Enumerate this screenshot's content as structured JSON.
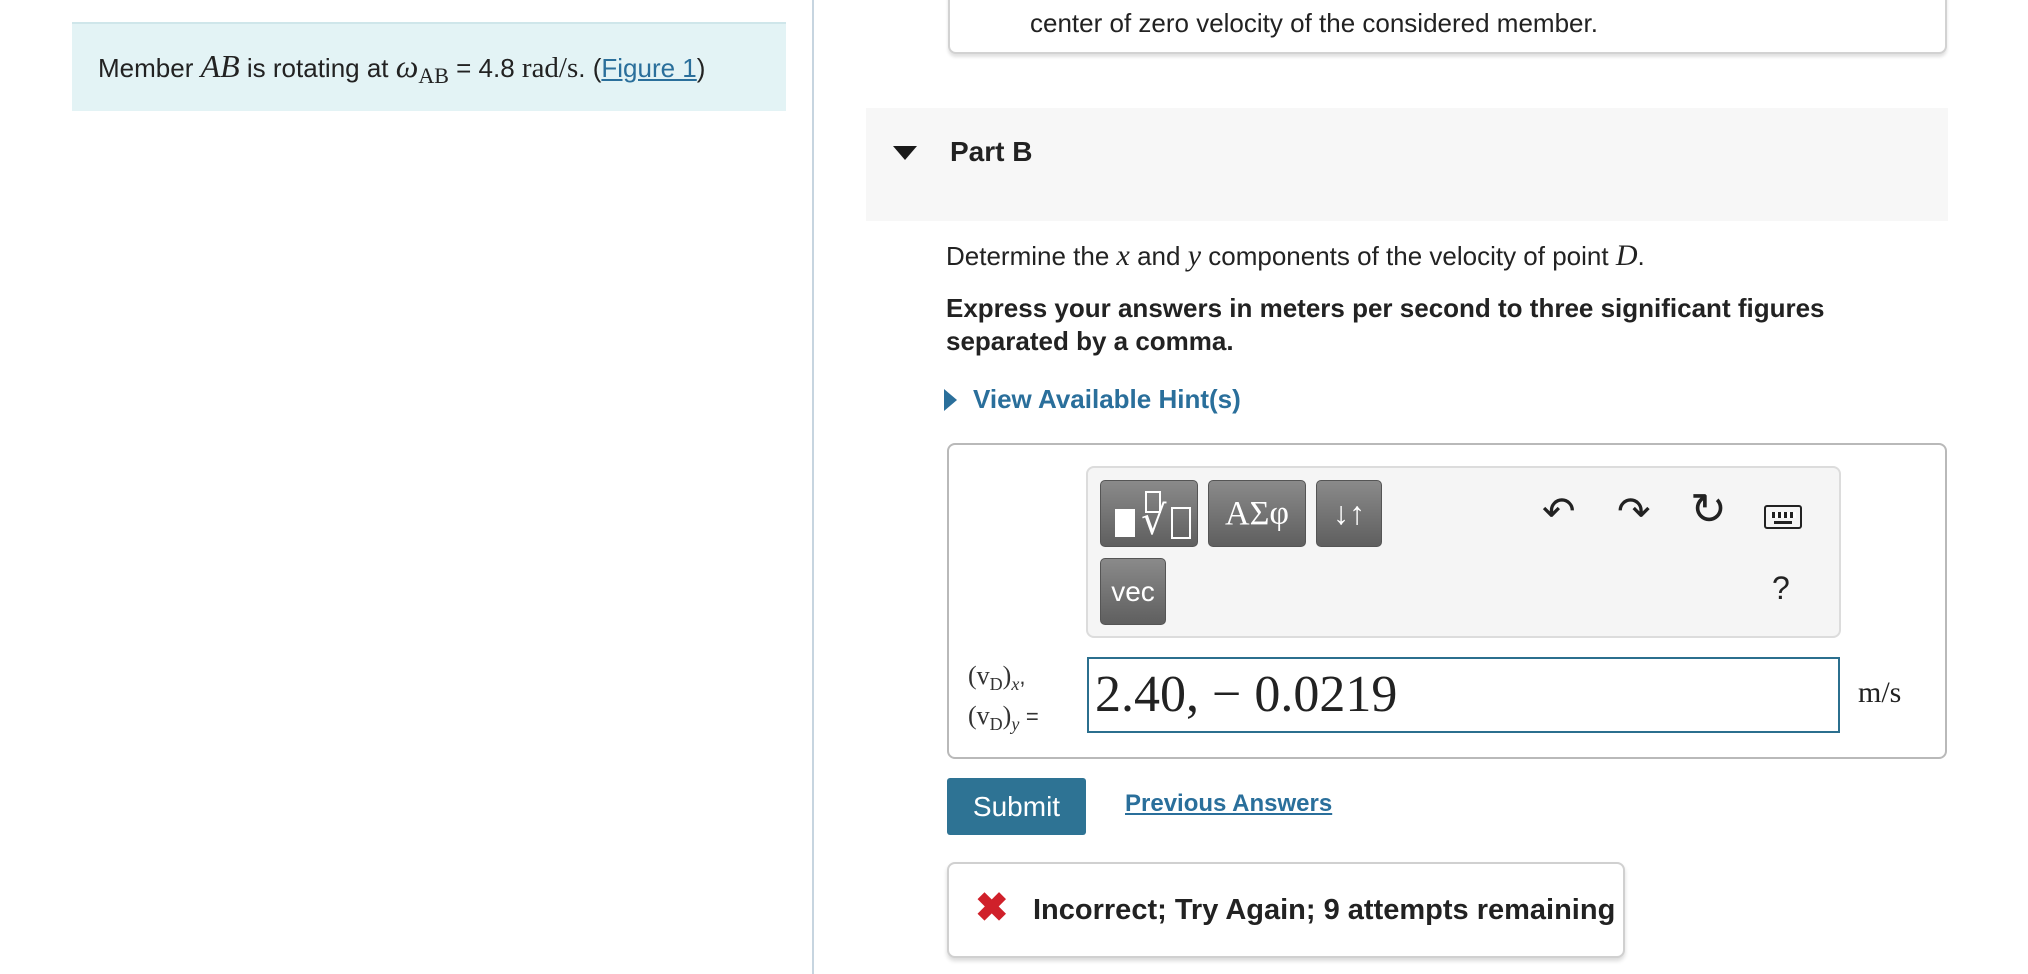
{
  "problem": {
    "prefix": "Member ",
    "member": "AB",
    "middle": " is rotating at ",
    "omega_symbol": "ω",
    "omega_sub": "AB",
    "value_text": " = 4.8 ",
    "units": "rad/s",
    "after": ". (",
    "figure_link": "Figure 1",
    "close": ")"
  },
  "previous_card_text": "center of zero velocity of the considered member.",
  "part": {
    "title": "Part B"
  },
  "question": {
    "t1": "Determine the ",
    "x": "x",
    "t2": " and ",
    "y": "y",
    "t3": " components of the velocity of point ",
    "point": "D",
    "t4": "."
  },
  "instructions": "Express your answers in meters per second to three significant figures separated by a comma.",
  "hint_label": "View Available Hint(s)",
  "toolbar": {
    "greek_label": "ΑΣφ",
    "arrows_label": "↓↑",
    "vec_label": "vec",
    "undo_icon": "↶",
    "redo_icon": "↷",
    "reset_icon": "↻",
    "help_label": "?"
  },
  "answer": {
    "label_line1": "(v",
    "label_sub_D1": "D",
    "label_x": "x",
    "label_line2": "(v",
    "label_sub_D2": "D",
    "label_y": "y",
    "value": "2.40, − 0.0219",
    "unit": "m/s"
  },
  "actions": {
    "submit_label": "Submit",
    "previous_answers_label": "Previous Answers"
  },
  "feedback": {
    "icon": "✖",
    "message": "Incorrect; Try Again; 9 attempts remaining",
    "color": "#d0202a"
  }
}
